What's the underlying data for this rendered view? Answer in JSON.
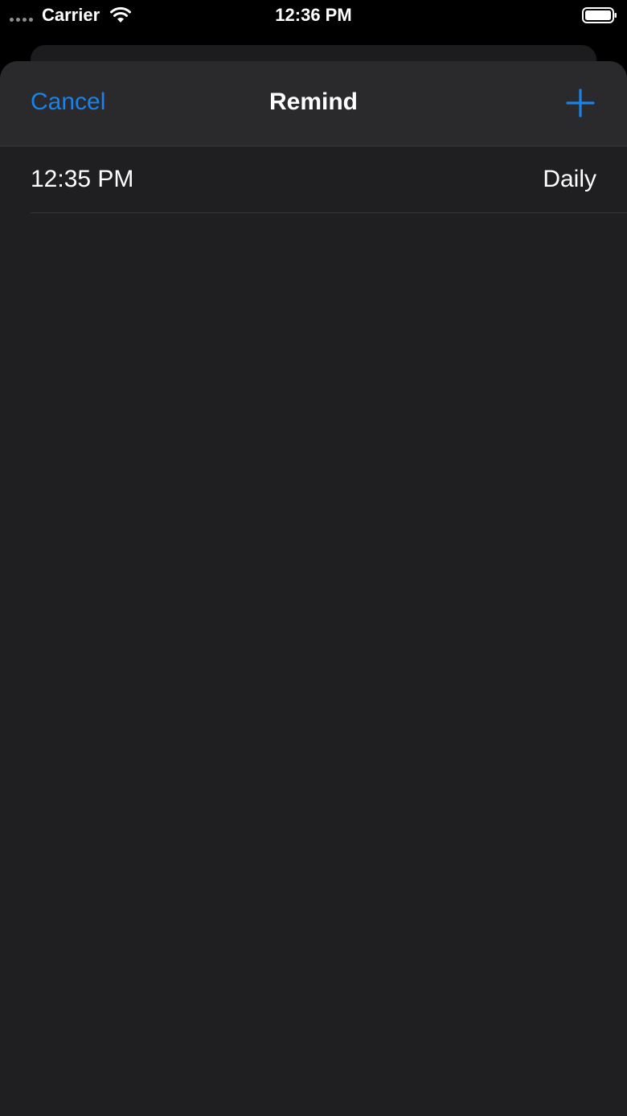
{
  "status_bar": {
    "carrier": "Carrier",
    "time": "12:36 PM",
    "wifi_icon": "wifi-icon",
    "battery_icon": "battery-full-icon"
  },
  "nav": {
    "cancel_label": "Cancel",
    "title": "Remind",
    "add_icon": "plus-icon",
    "accent_color": "#1a82e8"
  },
  "reminders": [
    {
      "time": "12:35 PM",
      "repeat": "Daily"
    }
  ]
}
